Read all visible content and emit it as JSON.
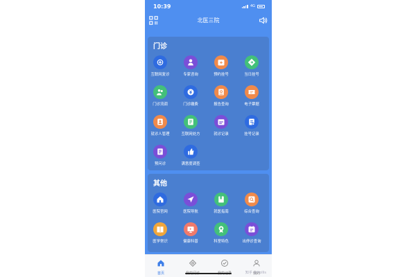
{
  "status": {
    "time": "10:39",
    "network": "4G"
  },
  "header": {
    "title": "北医三院",
    "qr_icon": "qr-code-icon",
    "speaker_icon": "speaker-icon"
  },
  "outpatient": {
    "heading": "门诊",
    "items": [
      {
        "label": "互联网复诊",
        "icon": "plus-icon",
        "color": "#2f6be0"
      },
      {
        "label": "专家咨询",
        "icon": "doctor-icon",
        "color": "#7a4fd8"
      },
      {
        "label": "预约挂号",
        "icon": "calendar-plus-icon",
        "color": "#f08a4b"
      },
      {
        "label": "当日挂号",
        "icon": "diamond-icon",
        "color": "#43c07a"
      },
      {
        "label": "门诊流调",
        "icon": "people-icon",
        "color": "#43c07a"
      },
      {
        "label": "门诊缴费",
        "icon": "coin-icon",
        "color": "#2f6be0"
      },
      {
        "label": "报告查询",
        "icon": "report-icon",
        "color": "#f08a4b"
      },
      {
        "label": "电子票据",
        "icon": "ticket-icon",
        "color": "#f08a4b"
      },
      {
        "label": "就诊人管理",
        "icon": "patient-icon",
        "color": "#f08a4b"
      },
      {
        "label": "互联网处方",
        "icon": "prescription-icon",
        "color": "#43c07a"
      },
      {
        "label": "就诊记录",
        "icon": "calendar-icon",
        "color": "#7a4fd8"
      },
      {
        "label": "挂号记录",
        "icon": "register-icon",
        "color": "#2f6be0"
      },
      {
        "label": "预问诊",
        "icon": "form-icon",
        "color": "#7a4fd8"
      },
      {
        "label": "满意度调查",
        "icon": "thumbs-up-icon",
        "color": "#2f6be0"
      }
    ]
  },
  "others": {
    "heading": "其他",
    "items": [
      {
        "label": "医院官网",
        "icon": "home-icon",
        "color": "#2f6be0"
      },
      {
        "label": "医院导航",
        "icon": "navigation-icon",
        "color": "#7a4fd8"
      },
      {
        "label": "就医指南",
        "icon": "guide-icon",
        "color": "#43c07a"
      },
      {
        "label": "综合查询",
        "icon": "search-icon",
        "color": "#f08a4b"
      },
      {
        "label": "医学常识",
        "icon": "book-icon",
        "color": "#f0a63b"
      },
      {
        "label": "健康科普",
        "icon": "slides-icon",
        "color": "#f07a6b"
      },
      {
        "label": "科室特色",
        "icon": "badge-icon",
        "color": "#43c07a"
      },
      {
        "label": "出停诊查询",
        "icon": "schedule-icon",
        "color": "#7a4fd8"
      }
    ]
  },
  "tabbar": [
    {
      "label": "首页",
      "icon": "home-tab-icon",
      "active": true
    },
    {
      "label": "我的问诊",
      "icon": "consult-tab-icon",
      "active": false
    },
    {
      "label": "我的记录",
      "icon": "record-tab-icon",
      "active": false
    },
    {
      "label": "我的",
      "icon": "user-tab-icon",
      "active": false
    }
  ],
  "watermark": "知乎 @Hollis"
}
